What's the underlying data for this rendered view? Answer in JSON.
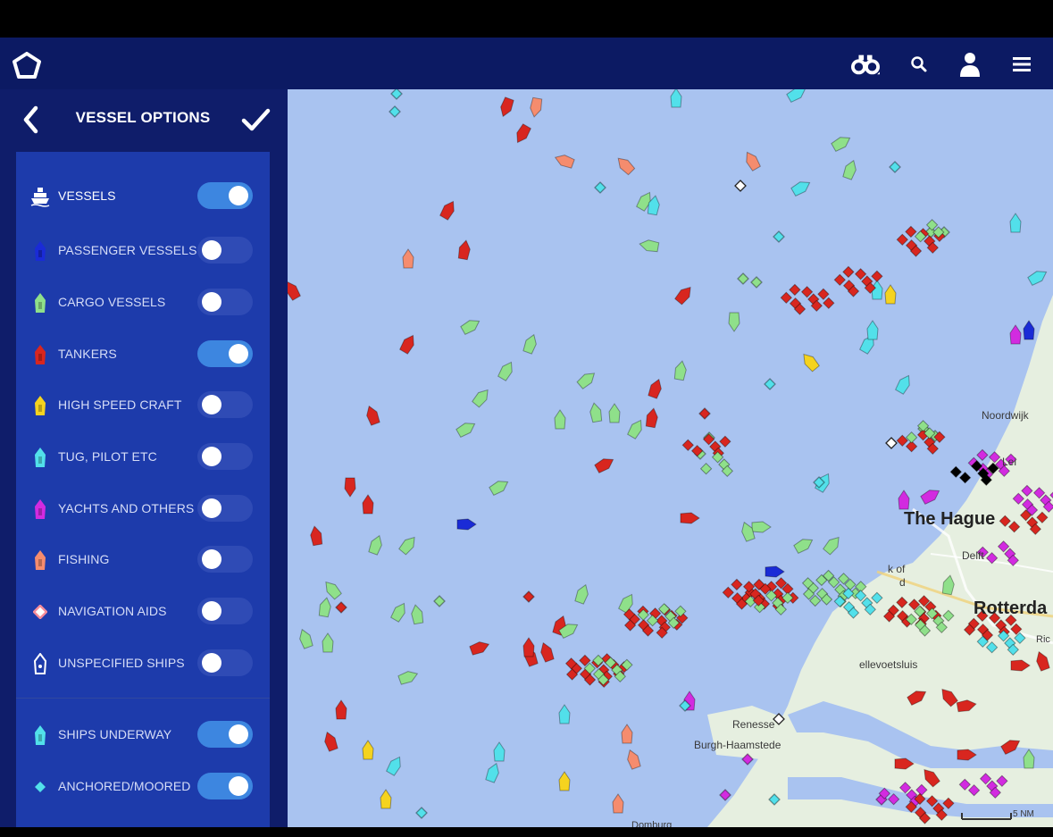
{
  "header": {
    "logo_icon": "pentagon-logo-icon",
    "icons": [
      "binoculars-icon",
      "search-icon",
      "user-icon",
      "hamburger-menu-icon"
    ]
  },
  "panel": {
    "title": "VESSEL OPTIONS",
    "back_icon": "chevron-left-icon",
    "confirm_icon": "checkmark-icon",
    "filters": [
      {
        "label": "VESSELS",
        "icon": "ship-icon",
        "color": "#ffffff",
        "on": true
      },
      {
        "label": "PASSENGER VESSELS",
        "icon": "passenger-vessel-icon",
        "color": "#1a2bd6",
        "on": false
      },
      {
        "label": "CARGO VESSELS",
        "icon": "cargo-vessel-icon",
        "color": "#8fe08a",
        "on": false
      },
      {
        "label": "TANKERS",
        "icon": "tanker-icon",
        "color": "#d8261f",
        "on": true
      },
      {
        "label": "HIGH SPEED CRAFT",
        "icon": "high-speed-craft-icon",
        "color": "#f5d31f",
        "on": false
      },
      {
        "label": "TUG, PILOT ETC",
        "icon": "tug-pilot-icon",
        "color": "#52e0ea",
        "on": false
      },
      {
        "label": "YACHTS AND OTHERS",
        "icon": "yacht-icon",
        "color": "#d22be0",
        "on": false
      },
      {
        "label": "FISHING",
        "icon": "fishing-vessel-icon",
        "color": "#f58c6e",
        "on": false
      },
      {
        "label": "NAVIGATION AIDS",
        "icon": "navigation-aid-icon",
        "color": "#f58c9a",
        "on": false
      },
      {
        "label": "UNSPECIFIED SHIPS",
        "icon": "unspecified-ship-icon",
        "color": "#ffffff",
        "on": false
      }
    ],
    "status_filters": [
      {
        "label": "SHIPS UNDERWAY",
        "icon": "ship-underway-icon",
        "color": "#52e0ea",
        "on": true
      },
      {
        "label": "ANCHORED/MOORED",
        "icon": "anchored-moored-icon",
        "color": "#52e0ea",
        "on": true
      }
    ]
  },
  "map": {
    "places": {
      "the_hague": "The Hague",
      "noordwijk": "Noordwijk",
      "leiden": "Lei",
      "delft": "Delft",
      "hoek": "k of",
      "hoek2": "d",
      "rotterdam": "Rotterda",
      "rijswijk": "Ric",
      "hellevoetsluis": "ellevoetsluis",
      "renesse": "Renesse",
      "burgh": "Burgh-Haamstede",
      "domburg": "Domburg"
    },
    "scale_label": "5 NM"
  }
}
